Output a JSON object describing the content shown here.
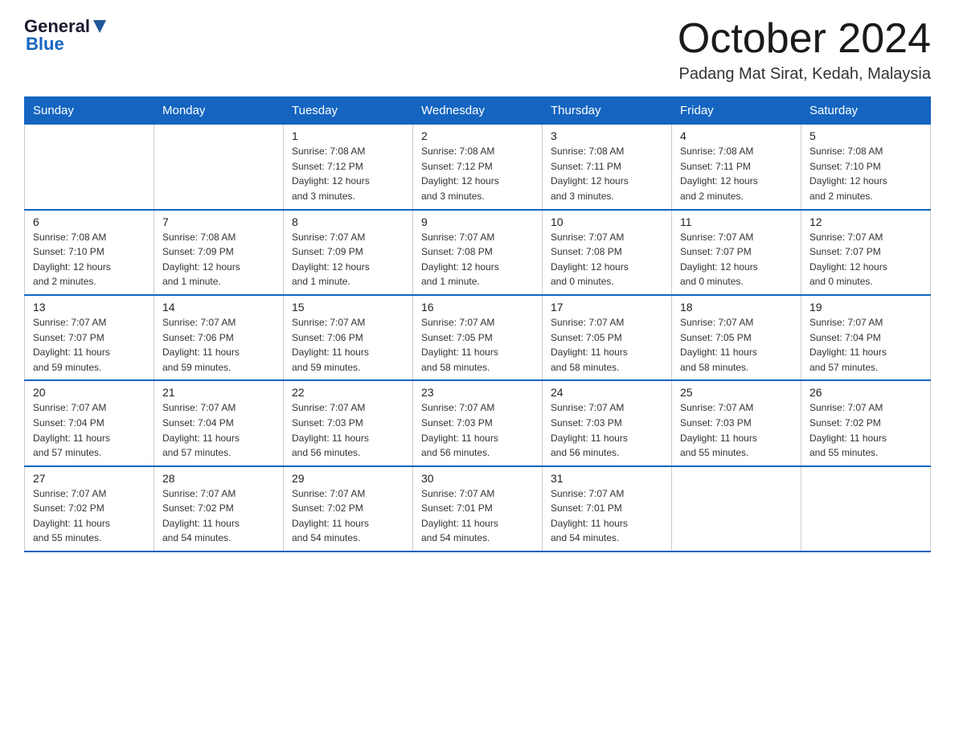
{
  "header": {
    "logo": {
      "general": "General",
      "blue": "Blue",
      "subtitle": "Blue"
    },
    "title": "October 2024",
    "location": "Padang Mat Sirat, Kedah, Malaysia"
  },
  "weekdays": [
    "Sunday",
    "Monday",
    "Tuesday",
    "Wednesday",
    "Thursday",
    "Friday",
    "Saturday"
  ],
  "weeks": [
    [
      {
        "day": "",
        "info": ""
      },
      {
        "day": "",
        "info": ""
      },
      {
        "day": "1",
        "info": "Sunrise: 7:08 AM\nSunset: 7:12 PM\nDaylight: 12 hours\nand 3 minutes."
      },
      {
        "day": "2",
        "info": "Sunrise: 7:08 AM\nSunset: 7:12 PM\nDaylight: 12 hours\nand 3 minutes."
      },
      {
        "day": "3",
        "info": "Sunrise: 7:08 AM\nSunset: 7:11 PM\nDaylight: 12 hours\nand 3 minutes."
      },
      {
        "day": "4",
        "info": "Sunrise: 7:08 AM\nSunset: 7:11 PM\nDaylight: 12 hours\nand 2 minutes."
      },
      {
        "day": "5",
        "info": "Sunrise: 7:08 AM\nSunset: 7:10 PM\nDaylight: 12 hours\nand 2 minutes."
      }
    ],
    [
      {
        "day": "6",
        "info": "Sunrise: 7:08 AM\nSunset: 7:10 PM\nDaylight: 12 hours\nand 2 minutes."
      },
      {
        "day": "7",
        "info": "Sunrise: 7:08 AM\nSunset: 7:09 PM\nDaylight: 12 hours\nand 1 minute."
      },
      {
        "day": "8",
        "info": "Sunrise: 7:07 AM\nSunset: 7:09 PM\nDaylight: 12 hours\nand 1 minute."
      },
      {
        "day": "9",
        "info": "Sunrise: 7:07 AM\nSunset: 7:08 PM\nDaylight: 12 hours\nand 1 minute."
      },
      {
        "day": "10",
        "info": "Sunrise: 7:07 AM\nSunset: 7:08 PM\nDaylight: 12 hours\nand 0 minutes."
      },
      {
        "day": "11",
        "info": "Sunrise: 7:07 AM\nSunset: 7:07 PM\nDaylight: 12 hours\nand 0 minutes."
      },
      {
        "day": "12",
        "info": "Sunrise: 7:07 AM\nSunset: 7:07 PM\nDaylight: 12 hours\nand 0 minutes."
      }
    ],
    [
      {
        "day": "13",
        "info": "Sunrise: 7:07 AM\nSunset: 7:07 PM\nDaylight: 11 hours\nand 59 minutes."
      },
      {
        "day": "14",
        "info": "Sunrise: 7:07 AM\nSunset: 7:06 PM\nDaylight: 11 hours\nand 59 minutes."
      },
      {
        "day": "15",
        "info": "Sunrise: 7:07 AM\nSunset: 7:06 PM\nDaylight: 11 hours\nand 59 minutes."
      },
      {
        "day": "16",
        "info": "Sunrise: 7:07 AM\nSunset: 7:05 PM\nDaylight: 11 hours\nand 58 minutes."
      },
      {
        "day": "17",
        "info": "Sunrise: 7:07 AM\nSunset: 7:05 PM\nDaylight: 11 hours\nand 58 minutes."
      },
      {
        "day": "18",
        "info": "Sunrise: 7:07 AM\nSunset: 7:05 PM\nDaylight: 11 hours\nand 58 minutes."
      },
      {
        "day": "19",
        "info": "Sunrise: 7:07 AM\nSunset: 7:04 PM\nDaylight: 11 hours\nand 57 minutes."
      }
    ],
    [
      {
        "day": "20",
        "info": "Sunrise: 7:07 AM\nSunset: 7:04 PM\nDaylight: 11 hours\nand 57 minutes."
      },
      {
        "day": "21",
        "info": "Sunrise: 7:07 AM\nSunset: 7:04 PM\nDaylight: 11 hours\nand 57 minutes."
      },
      {
        "day": "22",
        "info": "Sunrise: 7:07 AM\nSunset: 7:03 PM\nDaylight: 11 hours\nand 56 minutes."
      },
      {
        "day": "23",
        "info": "Sunrise: 7:07 AM\nSunset: 7:03 PM\nDaylight: 11 hours\nand 56 minutes."
      },
      {
        "day": "24",
        "info": "Sunrise: 7:07 AM\nSunset: 7:03 PM\nDaylight: 11 hours\nand 56 minutes."
      },
      {
        "day": "25",
        "info": "Sunrise: 7:07 AM\nSunset: 7:03 PM\nDaylight: 11 hours\nand 55 minutes."
      },
      {
        "day": "26",
        "info": "Sunrise: 7:07 AM\nSunset: 7:02 PM\nDaylight: 11 hours\nand 55 minutes."
      }
    ],
    [
      {
        "day": "27",
        "info": "Sunrise: 7:07 AM\nSunset: 7:02 PM\nDaylight: 11 hours\nand 55 minutes."
      },
      {
        "day": "28",
        "info": "Sunrise: 7:07 AM\nSunset: 7:02 PM\nDaylight: 11 hours\nand 54 minutes."
      },
      {
        "day": "29",
        "info": "Sunrise: 7:07 AM\nSunset: 7:02 PM\nDaylight: 11 hours\nand 54 minutes."
      },
      {
        "day": "30",
        "info": "Sunrise: 7:07 AM\nSunset: 7:01 PM\nDaylight: 11 hours\nand 54 minutes."
      },
      {
        "day": "31",
        "info": "Sunrise: 7:07 AM\nSunset: 7:01 PM\nDaylight: 11 hours\nand 54 minutes."
      },
      {
        "day": "",
        "info": ""
      },
      {
        "day": "",
        "info": ""
      }
    ]
  ]
}
